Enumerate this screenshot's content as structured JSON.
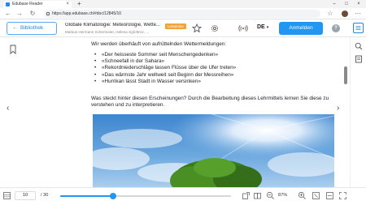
{
  "browser": {
    "tab_title": "Edubase Reader",
    "url": "https://app.edubase.ch/#doc/12845/10"
  },
  "header": {
    "back_label": "Bibliothek",
    "book_title": "Globale Klimatologie: Meteorologie, Wette...",
    "book_authors": "Markus Hermann Schermeier, Helena Sgli-Broz, ...",
    "badge": "Leseprobe",
    "language": "DE",
    "signin_label": "Anmelden",
    "help_label": "?"
  },
  "content": {
    "intro": "Wir werden überhäuft von aufrüttelnden Wettermeldungen:",
    "quotes": [
      "«Der heisseste Sommer seit Menschengedenken»",
      "«Schneefall in der Sahara»",
      "«Rekordniederschläge lassen Flüsse über die Ufer treten»",
      "«Das wärmste Jahr weltweit seit Beginn der Messreihen»",
      "«Hurrikan lässt Stadt in Wasser versinken»"
    ],
    "bullet": "•",
    "paragraph": "Was steckt hinter diesen Erscheinungen? Durch die Bearbeitung dieses Lehrmittels lernen Sie diese zu verstehen und zu interpretieren."
  },
  "footer": {
    "current_page": "10",
    "total_pages_label": "/ 30",
    "progress_fraction": 0.31,
    "zoom": "87%"
  },
  "colors": {
    "accent": "#2196f3",
    "badge": "#f2a33a"
  }
}
